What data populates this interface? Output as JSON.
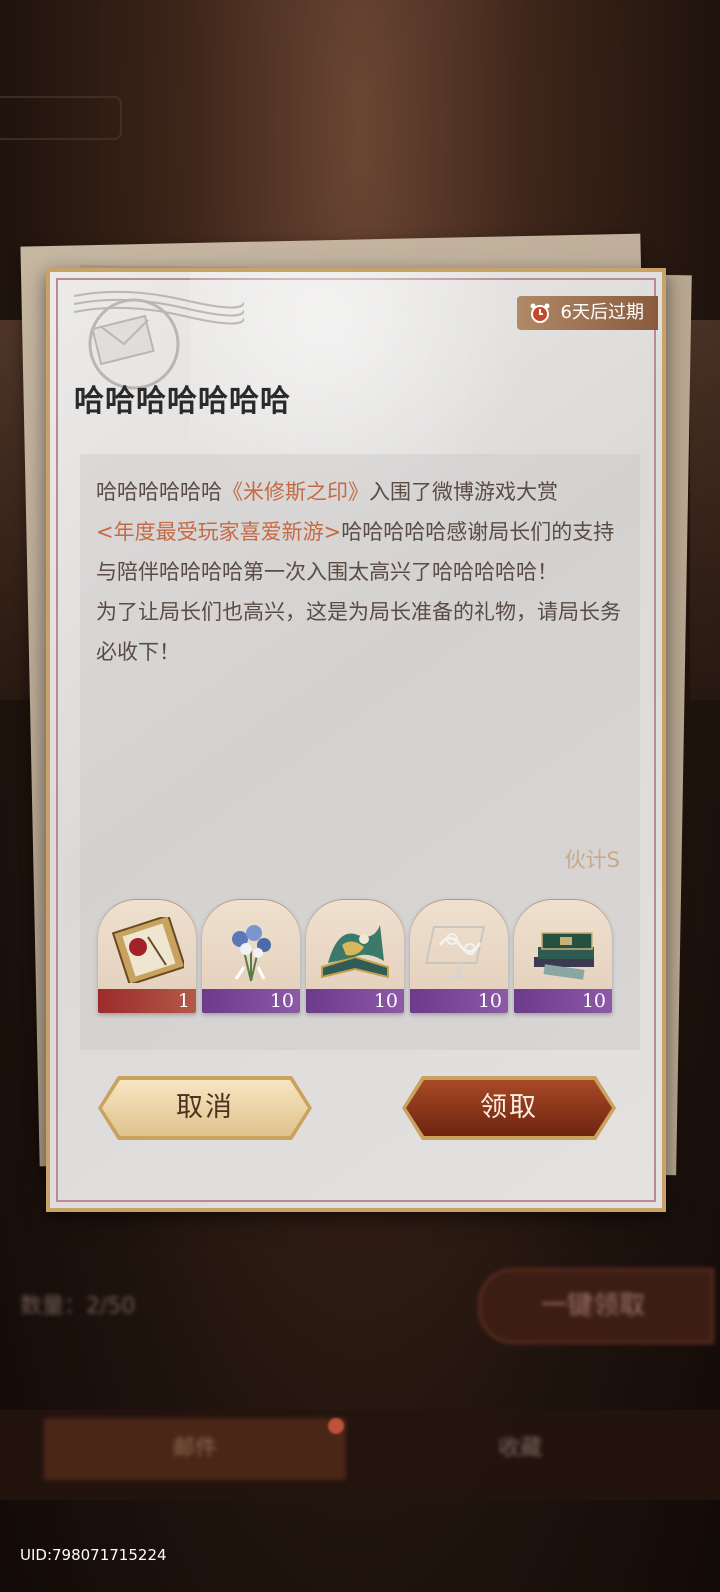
{
  "background": {
    "count_text": "数量：2/50",
    "one_key_label": "一键领取",
    "tabs": [
      "邮件",
      "收藏"
    ]
  },
  "letter": {
    "expire_label": "6天后过期",
    "title": "哈哈哈哈哈哈哈",
    "body": {
      "p1_a": "哈哈哈哈哈哈",
      "p1_game": "《米修斯之印》",
      "p1_b": "入围了微博游戏大赏",
      "p1_award": "<年度最受玩家喜爱新游>",
      "p1_c": "哈哈哈哈哈感谢局长们的支持与陪伴哈哈哈哈第一次入围太高兴了哈哈哈哈哈！",
      "p2": "为了让局长们也高兴，这是为局长准备的礼物，请局长务必收下！"
    },
    "sender": "伙计S",
    "items": [
      {
        "icon": "letter-box-icon",
        "count": "1",
        "quality_color": "#9b2b2b"
      },
      {
        "icon": "bouquet-icon",
        "count": "10",
        "quality_color": "#6d3a8c"
      },
      {
        "icon": "popup-book-icon",
        "count": "10",
        "quality_color": "#6d3a8c"
      },
      {
        "icon": "silver-ornament-icon",
        "count": "10",
        "quality_color": "#6d3a8c"
      },
      {
        "icon": "books-icon",
        "count": "10",
        "quality_color": "#6d3a8c"
      }
    ],
    "cancel_label": "取消",
    "claim_label": "领取"
  },
  "footer": {
    "uid": "UID:798071715224"
  },
  "colors": {
    "accent": "#c66a45",
    "gold_border": "#c9a26a",
    "claim_button": "#8a3418"
  }
}
